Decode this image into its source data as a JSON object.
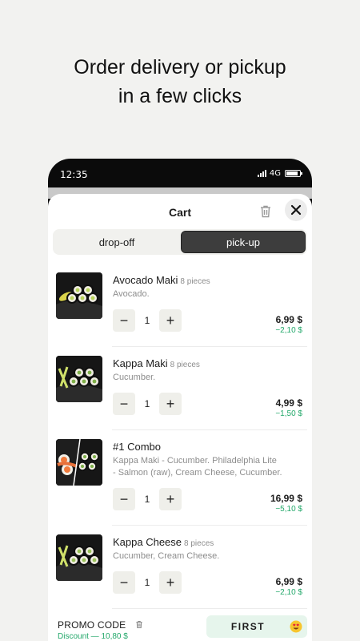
{
  "headline": {
    "line1": "Order delivery or pickup",
    "line2": "in a few clicks"
  },
  "status_bar": {
    "time": "12:35",
    "network": "4G",
    "icons": [
      "signal-icon",
      "battery-icon"
    ]
  },
  "cart": {
    "title": "Cart",
    "icons": {
      "clear": "trash-icon",
      "close": "close-icon"
    },
    "tabs": [
      {
        "label": "drop-off",
        "selected": false
      },
      {
        "label": "pick-up",
        "selected": true
      }
    ],
    "items": [
      {
        "name": "Avocado Maki",
        "pieces": "8 pieces",
        "description": "Avocado.",
        "quantity": "1",
        "price": "6,99 $",
        "discount": "−2,10 $"
      },
      {
        "name": "Kappa Maki",
        "pieces": "8 pieces",
        "description": "Cucumber.",
        "quantity": "1",
        "price": "4,99 $",
        "discount": "−1,50 $"
      },
      {
        "name": "#1 Combo",
        "pieces": "",
        "description_line1": "Kappa Maki - Cucumber. Philadelphia Lite",
        "description_line2": "- Salmon (raw), Cream Cheese, Cucumber.",
        "quantity": "1",
        "price": "16,99 $",
        "discount": "−5,10 $"
      },
      {
        "name": "Kappa Cheese",
        "pieces": "8 pieces",
        "description": "Cucumber, Cream Cheese.",
        "quantity": "1",
        "price": "6,99 $",
        "discount": "−2,10 $"
      }
    ],
    "stepper_minus": "−",
    "stepper_plus": "+",
    "promo": {
      "label": "PROMO CODE",
      "discount": "Discount — 10,80 $",
      "code": "FIRST"
    },
    "colors": {
      "accent_green": "#23a86a",
      "promo_bg": "#e6f5ec",
      "selected_tab": "#3d3d3d"
    }
  }
}
